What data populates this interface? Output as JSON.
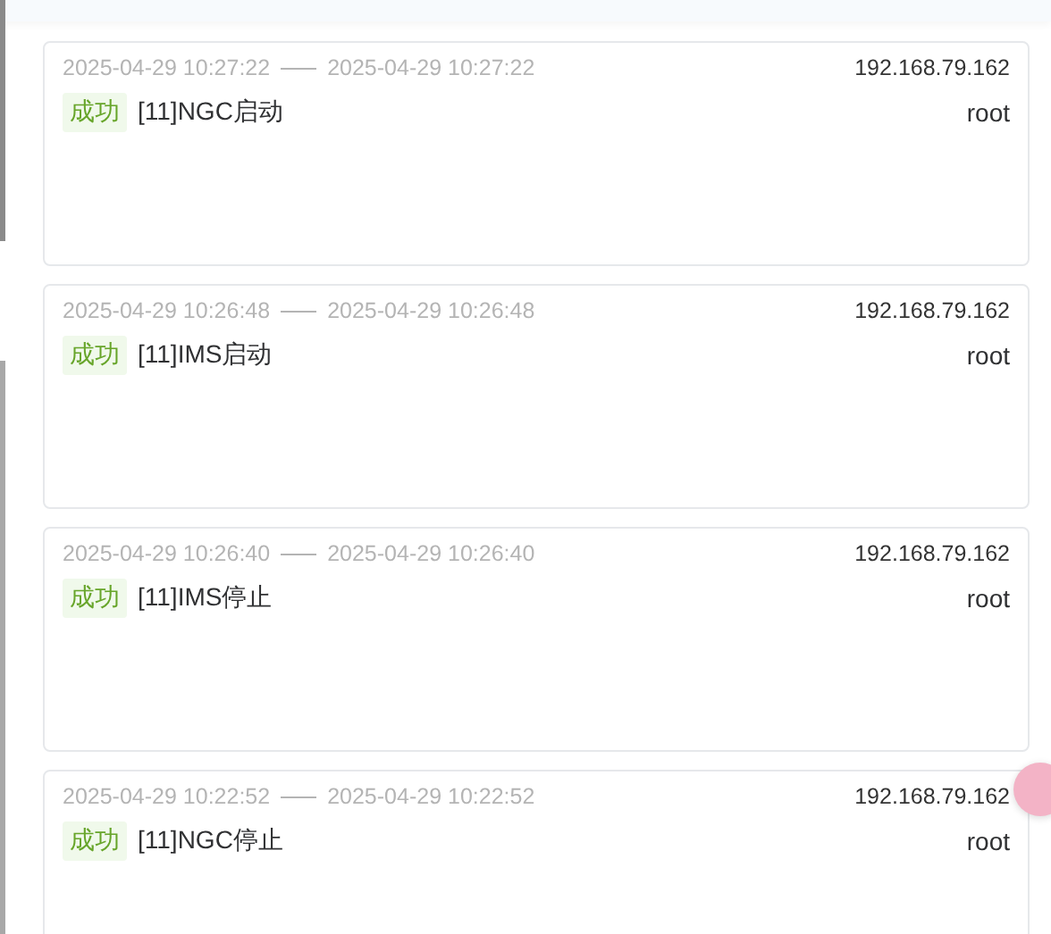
{
  "logs": [
    {
      "start": "2025-04-29 10:27:22",
      "end": "2025-04-29 10:27:22",
      "ip": "192.168.79.162",
      "status": "成功",
      "message": "[11]NGC启动",
      "user": "root"
    },
    {
      "start": "2025-04-29 10:26:48",
      "end": "2025-04-29 10:26:48",
      "ip": "192.168.79.162",
      "status": "成功",
      "message": "[11]IMS启动",
      "user": "root"
    },
    {
      "start": "2025-04-29 10:26:40",
      "end": "2025-04-29 10:26:40",
      "ip": "192.168.79.162",
      "status": "成功",
      "message": "[11]IMS停止",
      "user": "root"
    },
    {
      "start": "2025-04-29 10:22:52",
      "end": "2025-04-29 10:22:52",
      "ip": "192.168.79.162",
      "status": "成功",
      "message": "[11]NGC停止",
      "user": "root"
    }
  ]
}
